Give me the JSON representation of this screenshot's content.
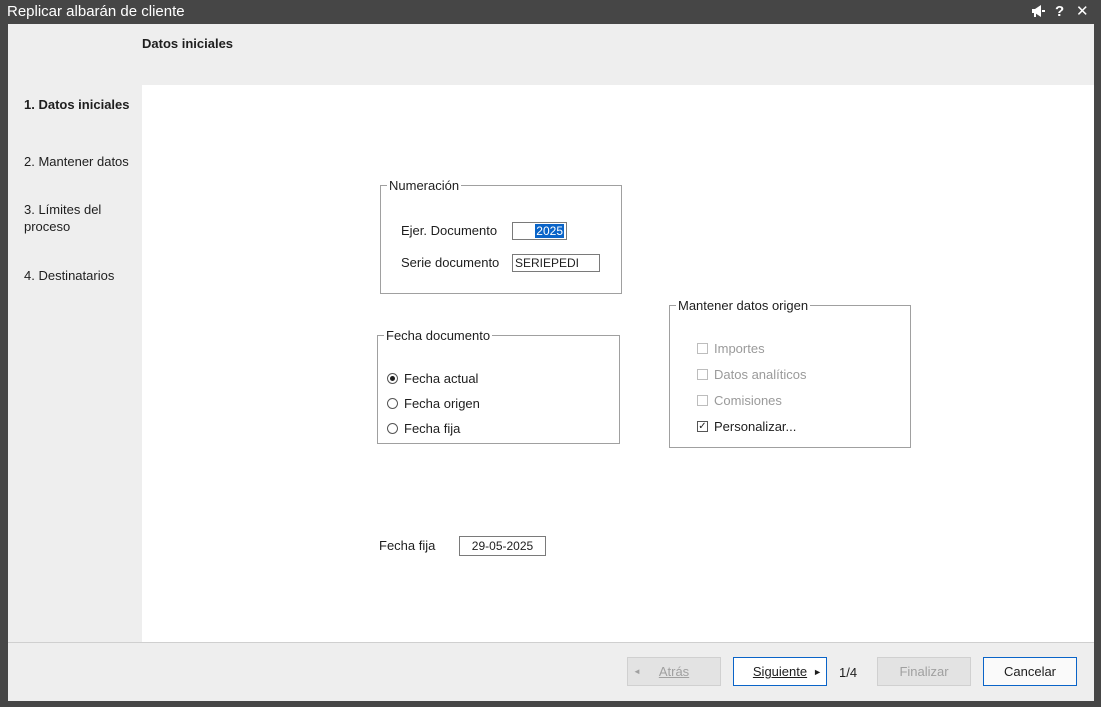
{
  "window": {
    "title": "Replicar albarán de cliente"
  },
  "titlebar_icons": [
    "megaphone-icon",
    "help-icon",
    "close-icon"
  ],
  "header": {
    "title": "Datos iniciales"
  },
  "steps": [
    {
      "label": "1. Datos iniciales",
      "active": true
    },
    {
      "label": "2. Mantener datos",
      "active": false
    },
    {
      "label": "3. Límites del proceso",
      "active": false
    },
    {
      "label": "4. Destinatarios",
      "active": false
    }
  ],
  "numeracion": {
    "legend": "Numeración",
    "ejer_label": "Ejer. Documento",
    "ejer_value": "2025",
    "serie_label": "Serie documento",
    "serie_value": "SERIEPEDI"
  },
  "fecha_documento": {
    "legend": "Fecha documento",
    "options": [
      {
        "label": "Fecha actual",
        "selected": true
      },
      {
        "label": "Fecha origen",
        "selected": false
      },
      {
        "label": "Fecha fija",
        "selected": false
      }
    ]
  },
  "mantener": {
    "legend": "Mantener datos origen",
    "options": [
      {
        "label": "Importes",
        "checked": false,
        "enabled": false
      },
      {
        "label": "Datos analíticos",
        "checked": false,
        "enabled": false
      },
      {
        "label": "Comisiones",
        "checked": false,
        "enabled": false
      },
      {
        "label": "Personalizar...",
        "checked": true,
        "enabled": true
      }
    ]
  },
  "fecha_fija": {
    "label": "Fecha fija",
    "value": "29-05-2025"
  },
  "footer": {
    "back_label": "Atrás",
    "next_label": "Siguiente",
    "page": "1/4",
    "finish_label": "Finalizar",
    "cancel_label": "Cancelar"
  },
  "colors": {
    "titlebar": "#464646",
    "accent": "#0a64c8",
    "panel": "#eeeeee",
    "content": "#ffffff"
  }
}
